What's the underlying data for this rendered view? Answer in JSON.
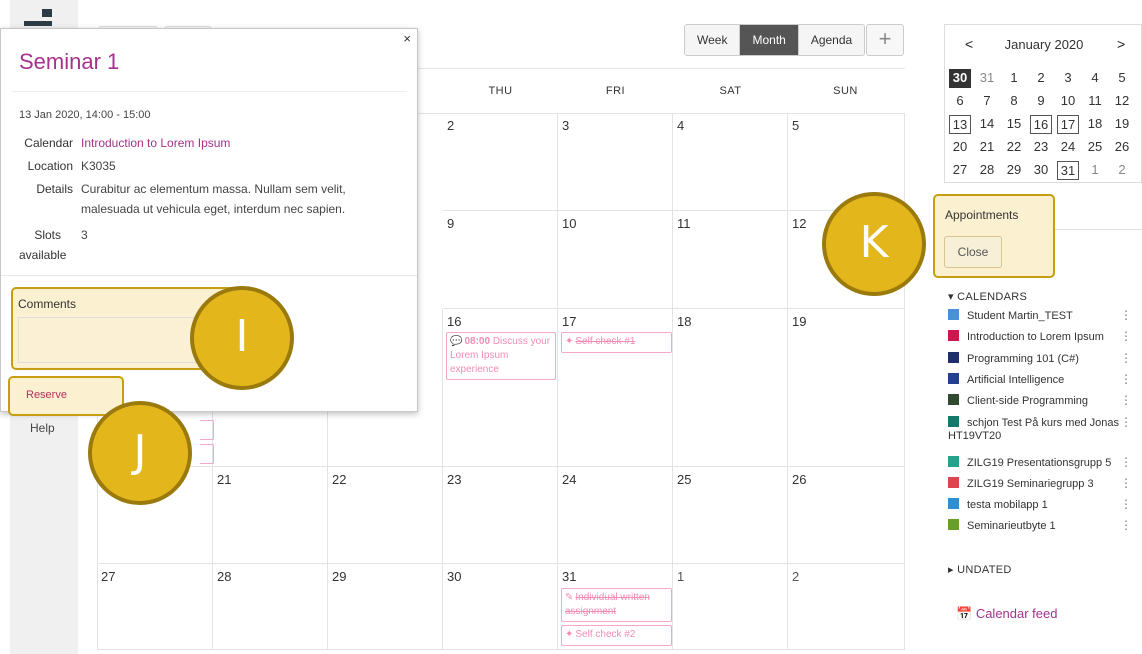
{
  "toolbar": {
    "views": [
      {
        "label": "Week",
        "active": false
      },
      {
        "label": "Month",
        "active": true
      },
      {
        "label": "Agenda",
        "active": false
      }
    ],
    "add_label": "+"
  },
  "calendar": {
    "weekdays": [
      "",
      "",
      "",
      "THU",
      "FRI",
      "SAT",
      "SUN"
    ],
    "weeks": [
      [
        "",
        "",
        "",
        "2",
        "3",
        "4",
        "5"
      ],
      [
        "",
        "",
        "",
        "9",
        "10",
        "11",
        "12"
      ],
      [
        "",
        "",
        "",
        "16",
        "17",
        "18",
        "19"
      ],
      [
        "",
        "21",
        "22",
        "23",
        "24",
        "25",
        "26"
      ],
      [
        "27",
        "28",
        "29",
        "30",
        "31",
        "1",
        "2"
      ]
    ],
    "events": {
      "thu16": {
        "time": "08:00",
        "text": "Discuss your Lorem Ipsum experience"
      },
      "fri17": {
        "text": "Self check #1"
      },
      "fri31a": {
        "text": "Individual written assignment"
      },
      "fri31b": {
        "text": "Self check #2"
      }
    }
  },
  "popup": {
    "close": "×",
    "title": "Seminar 1",
    "datetime": "13 Jan 2020, 14:00 - 15:00",
    "calendar_label": "Calendar",
    "calendar_value": "Introduction to Lorem Ipsum",
    "location_label": "Location",
    "location_value": "K3035",
    "details_label": "Details",
    "details_line1": "Curabitur ac elementum massa. Nullam sem velit,",
    "details_line2": "malesuada ut vehicula eget, interdum nec sapien.",
    "slots_label_1": "Slots",
    "slots_label_2": "available",
    "slots_value": "3",
    "comments_label": "Comments",
    "reserve_label": "Reserve"
  },
  "left_nav": {
    "help": "Help"
  },
  "markers": {
    "i": "I",
    "j": "J",
    "k": "K"
  },
  "mini_calendar": {
    "title": "January 2020",
    "prev": "<",
    "next": ">",
    "rows": [
      [
        "30",
        "31",
        "1",
        "2",
        "3",
        "4",
        "5"
      ],
      [
        "6",
        "7",
        "8",
        "9",
        "10",
        "11",
        "12"
      ],
      [
        "13",
        "14",
        "15",
        "16",
        "17",
        "18",
        "19"
      ],
      [
        "20",
        "21",
        "22",
        "23",
        "24",
        "25",
        "26"
      ],
      [
        "27",
        "28",
        "29",
        "30",
        "31",
        "1",
        "2"
      ]
    ]
  },
  "appointments": {
    "label": "Appointments",
    "close": "Close"
  },
  "calendars": {
    "heading": "▾ CALENDARS",
    "items": [
      {
        "name": "Student Martin_TEST",
        "color": "#4a90d9"
      },
      {
        "name": "Introduction to Lorem Ipsum",
        "color": "#d0164f"
      },
      {
        "name": "Programming 101 (C#)",
        "color": "#1f2f6b"
      },
      {
        "name": "Artificial Intelligence",
        "color": "#23408e"
      },
      {
        "name": "Client-side Programming",
        "color": "#2f4a2f"
      },
      {
        "name": "schjon Test På kurs med Jonas",
        "name2": "HT19VT20",
        "color": "#137a6a"
      },
      {
        "name": "ZILG19 Presentationsgrupp 5",
        "color": "#22a38a"
      },
      {
        "name": "ZILG19 Seminariegrupp 3",
        "color": "#e0434e"
      },
      {
        "name": "testa mobilapp 1",
        "color": "#2f8fd0"
      },
      {
        "name": "Seminarieutbyte 1",
        "color": "#6a9e2a"
      }
    ],
    "undated": "▸ UNDATED",
    "feed": "Calendar feed"
  }
}
